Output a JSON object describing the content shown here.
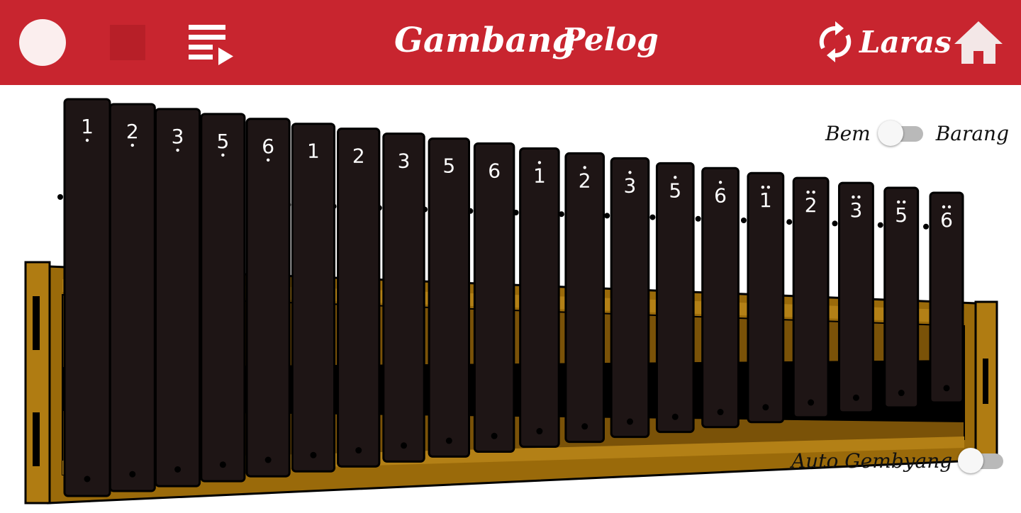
{
  "header": {
    "title": "Gambang",
    "subtitle": "Pelog",
    "laras_label": "Laras",
    "icons": [
      "record-circle-icon",
      "stop-square-icon",
      "playlist-play-icon",
      "sync-icon",
      "home-icon"
    ],
    "colors": {
      "bar": "#c8252f",
      "record": "#fbeeee",
      "stop": "#b71f28",
      "text": "#ffffff"
    }
  },
  "tuning_switch": {
    "left_label": "Bem",
    "right_label": "Barang",
    "state": "Bem"
  },
  "auto_switch": {
    "label": "Auto Gembyang",
    "checked": false
  },
  "instrument": {
    "colors": {
      "key": "#1e1515",
      "frame": "#9a6a0a",
      "frame_dark": "#6e4a06"
    },
    "keys": [
      {
        "digit": "1",
        "octave": -1
      },
      {
        "digit": "2",
        "octave": -1
      },
      {
        "digit": "3",
        "octave": -1
      },
      {
        "digit": "5",
        "octave": -1
      },
      {
        "digit": "6",
        "octave": -1
      },
      {
        "digit": "1",
        "octave": 0
      },
      {
        "digit": "2",
        "octave": 0
      },
      {
        "digit": "3",
        "octave": 0
      },
      {
        "digit": "5",
        "octave": 0
      },
      {
        "digit": "6",
        "octave": 0
      },
      {
        "digit": "1",
        "octave": 1
      },
      {
        "digit": "2",
        "octave": 1
      },
      {
        "digit": "3",
        "octave": 1
      },
      {
        "digit": "5",
        "octave": 1
      },
      {
        "digit": "6",
        "octave": 1
      },
      {
        "digit": "1",
        "octave": 2
      },
      {
        "digit": "2",
        "octave": 2
      },
      {
        "digit": "3",
        "octave": 2
      },
      {
        "digit": "5",
        "octave": 2
      },
      {
        "digit": "6",
        "octave": 2
      }
    ]
  }
}
